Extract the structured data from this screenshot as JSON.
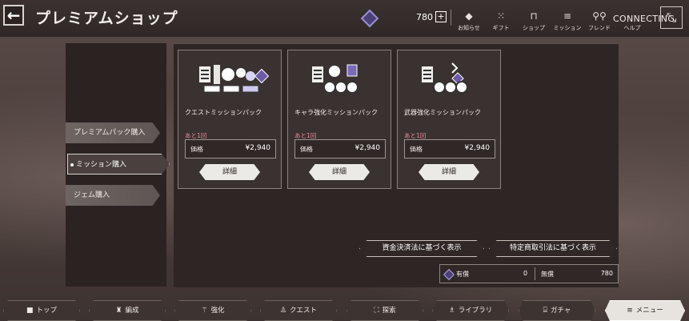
{
  "header": {
    "title": "プレミアムショップ",
    "gem_count": "780",
    "plus": "+",
    "connecting": "CONNECTING",
    "nav": [
      {
        "label": "お知らせ",
        "icon": "bell-icon",
        "glyph": "◆"
      },
      {
        "label": "ギフト",
        "icon": "gift-icon",
        "glyph": "⁙"
      },
      {
        "label": "ショップ",
        "icon": "shop-icon",
        "glyph": "⊓"
      },
      {
        "label": "ミッション",
        "icon": "mission-icon",
        "glyph": "≡"
      },
      {
        "label": "フレンド",
        "icon": "friend-icon",
        "glyph": "⚲⚲"
      },
      {
        "label": "ヘルプ",
        "icon": "help-icon",
        "glyph": "?"
      }
    ]
  },
  "sidebar": {
    "tabs": [
      {
        "label": "プレミアムパック購入",
        "active": false
      },
      {
        "label": "ミッション購入",
        "active": true
      },
      {
        "label": "ジェム購入",
        "active": false
      }
    ]
  },
  "cards": [
    {
      "name": "クエストミッションパック",
      "limit": "あと1回",
      "price_label": "価格",
      "price": "¥2,940",
      "button": "詳細"
    },
    {
      "name": "キャラ強化ミッションパック",
      "limit": "あと1回",
      "price_label": "価格",
      "price": "¥2,940",
      "button": "詳細"
    },
    {
      "name": "武器強化ミッションパック",
      "limit": "あと1回",
      "price_label": "価格",
      "price": "¥2,940",
      "button": "詳細"
    }
  ],
  "legal": {
    "funds_settlement": "資金決済法に基づく表示",
    "commercial_transactions": "特定商取引法に基づく表示"
  },
  "balance": {
    "paid_label": "有償",
    "paid_value": "0",
    "free_label": "無償",
    "free_value": "780"
  },
  "bottom_nav": [
    {
      "label": "トップ",
      "icon": "home-icon",
      "glyph": "■",
      "active": false
    },
    {
      "label": "編成",
      "icon": "formation-icon",
      "glyph": "♜",
      "active": false
    },
    {
      "label": "強化",
      "icon": "upgrade-icon",
      "glyph": "⚚",
      "active": false
    },
    {
      "label": "クエスト",
      "icon": "quest-icon",
      "glyph": "♙",
      "active": false
    },
    {
      "label": "探索",
      "icon": "explore-icon",
      "glyph": "⛶",
      "active": false
    },
    {
      "label": "ライブラリ",
      "icon": "library-icon",
      "glyph": "♗",
      "active": false
    },
    {
      "label": "ガチャ",
      "icon": "gacha-icon",
      "glyph": "⌸",
      "active": false
    },
    {
      "label": "メニュー",
      "icon": "menu-icon",
      "glyph": "≡",
      "active": true
    }
  ],
  "colors": {
    "accent_limit": "#e88c9a",
    "gem": "#4c3f7a"
  }
}
